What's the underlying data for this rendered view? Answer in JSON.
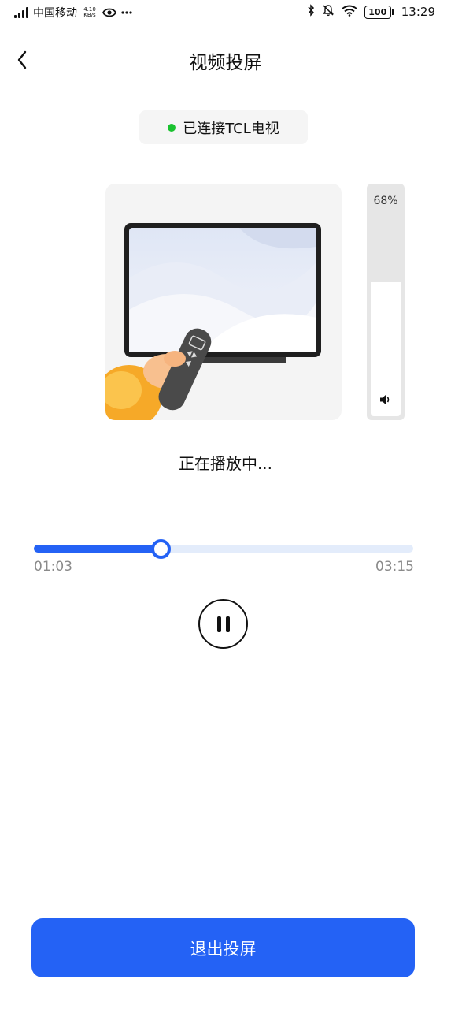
{
  "status_bar": {
    "carrier": "中国移动",
    "net_speed_value": "4.10",
    "net_speed_unit": "KB/s",
    "battery": "100",
    "time": "13:29",
    "icons": [
      "signal-icon",
      "eye-icon",
      "more-icon",
      "bluetooth-icon",
      "mute-icon",
      "wifi-icon",
      "battery-icon"
    ]
  },
  "header": {
    "title": "视频投屏",
    "back_icon": "chevron-left-icon"
  },
  "connection": {
    "status_text": "已连接TCL电视",
    "status_color": "#19c22f"
  },
  "volume": {
    "percent_label": "68%",
    "level": 0.68,
    "icon": "speaker-icon"
  },
  "playback": {
    "status_text": "正在播放中...",
    "current_time": "01:03",
    "total_time": "03:15",
    "progress": 0.335,
    "control_icon": "pause-icon"
  },
  "actions": {
    "exit_label": "退出投屏"
  },
  "colors": {
    "accent": "#2462f5",
    "track": "#e3ecfb"
  }
}
